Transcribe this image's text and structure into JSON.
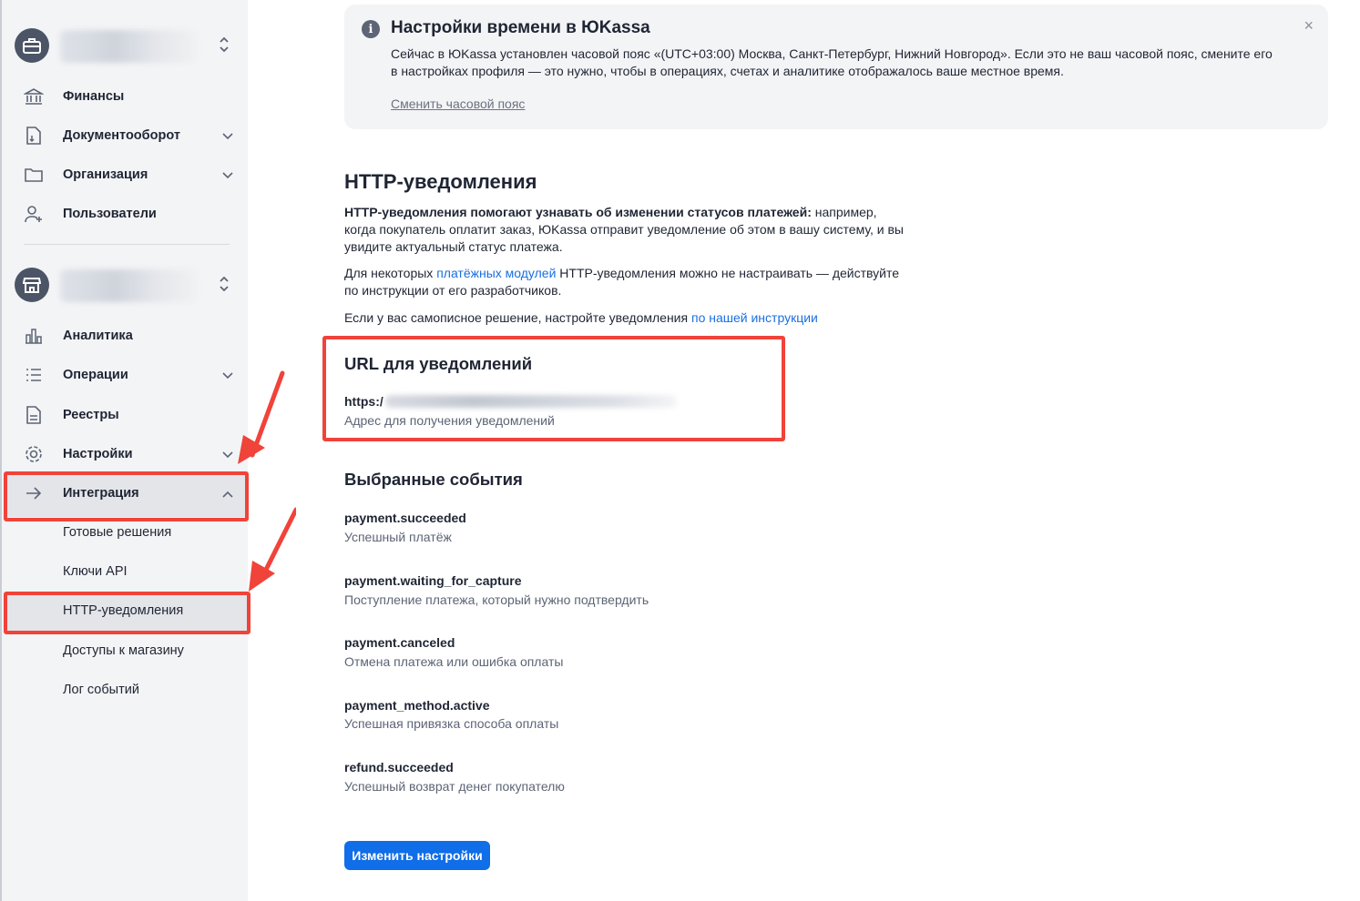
{
  "sidebar": {
    "nav_top": [
      {
        "label": "Финансы",
        "icon": "bank-icon"
      },
      {
        "label": "Документооборот",
        "icon": "document-exchange-icon"
      },
      {
        "label": "Организация",
        "icon": "folder-icon"
      },
      {
        "label": "Пользователи",
        "icon": "user-add-icon"
      }
    ],
    "nav_shop": [
      {
        "label": "Аналитика",
        "icon": "bar-chart-icon"
      },
      {
        "label": "Операции",
        "icon": "list-icon"
      },
      {
        "label": "Реестры",
        "icon": "file-icon"
      },
      {
        "label": "Настройки",
        "icon": "gear-icon"
      },
      {
        "label": "Интеграция",
        "icon": "arrow-right-icon"
      }
    ],
    "integration_sub": [
      {
        "label": "Готовые решения"
      },
      {
        "label": "Ключи API"
      },
      {
        "label": "HTTP-уведомления"
      },
      {
        "label": "Доступы к магазину"
      },
      {
        "label": "Лог событий"
      }
    ]
  },
  "notice": {
    "title": "Настройки времени в ЮKassa",
    "body": "Сейчас в ЮKassa установлен часовой пояс «(UTC+03:00) Москва, Санкт-Петербург, Нижний Новгород». Если это не ваш часовой пояс, смените его в настройках профиля — это нужно, чтобы в операциях, счетах и аналитике отображалось ваше местное время.",
    "link": "Сменить часовой пояс",
    "close": "×"
  },
  "main": {
    "title": "HTTP-уведомления",
    "intro_bold": "HTTP-уведомления помогают узнавать об изменении статусов платежей:",
    "intro_rest": " например, когда покупатель оплатит заказ, ЮKassa отправит уведомление об этом в вашу систему, и вы увидите актуальный статус платежа.",
    "modules_pre": "Для некоторых ",
    "modules_link": "платёжных модулей",
    "modules_post": " HTTP-уведомления можно не настраивать — действуйте по инструкции от его разработчиков.",
    "custom_pre": "Если у вас самописное решение, настройте уведомления ",
    "custom_link": "по нашей инструкции",
    "url_title": "URL для уведомлений",
    "url_value": "https:/",
    "url_caption": "Адрес для получения уведомлений",
    "events_title": "Выбранные события",
    "events": [
      {
        "name": "payment.succeeded",
        "desc": "Успешный платёж"
      },
      {
        "name": "payment.waiting_for_capture",
        "desc": "Поступление платежа, который нужно подтвердить"
      },
      {
        "name": "payment.canceled",
        "desc": "Отмена платежа или ошибка оплаты"
      },
      {
        "name": "payment_method.active",
        "desc": "Успешная привязка способа оплаты"
      },
      {
        "name": "refund.succeeded",
        "desc": "Успешный возврат денег покупателю"
      }
    ],
    "button": "Изменить настройки"
  },
  "colors": {
    "accent": "#0f6ee8",
    "highlight": "#f0433a",
    "link": "#1a6fe0"
  }
}
